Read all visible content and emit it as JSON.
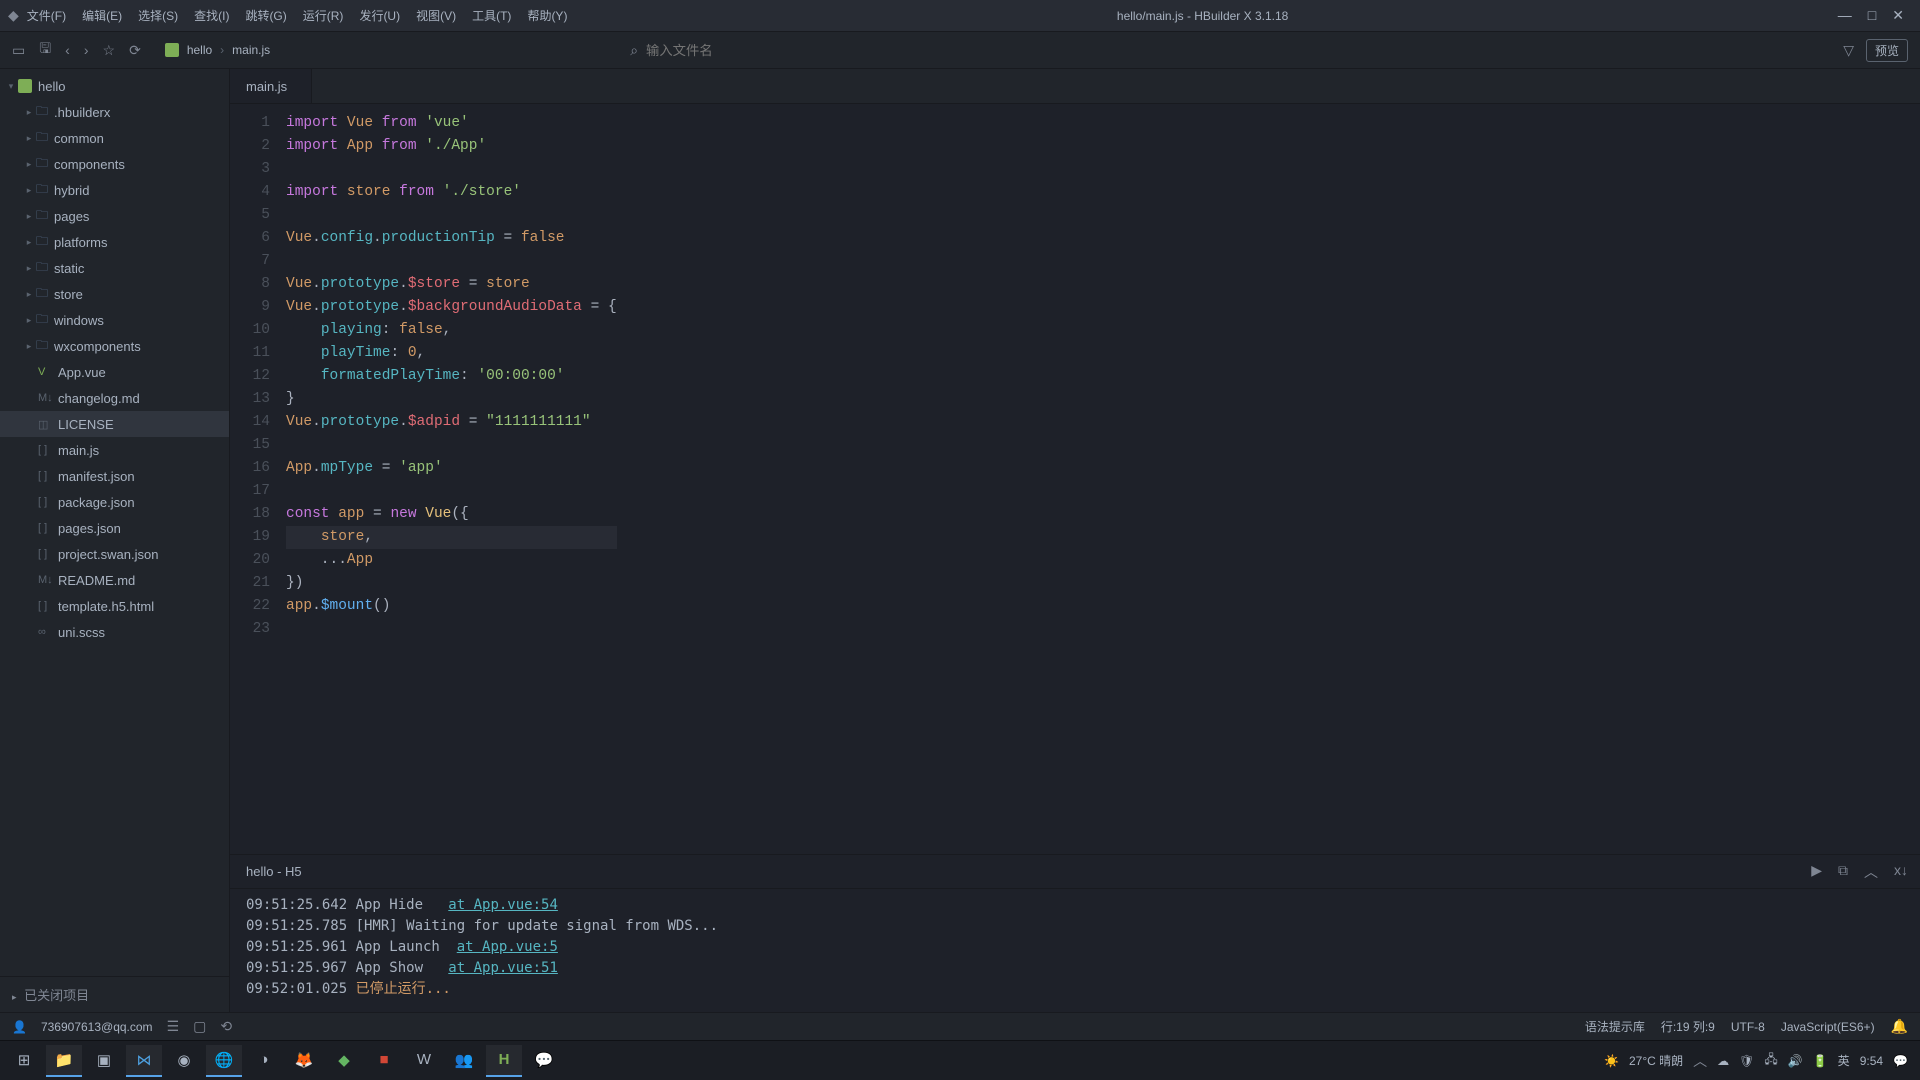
{
  "menubar": {
    "items": [
      "文件(F)",
      "编辑(E)",
      "选择(S)",
      "查找(I)",
      "跳转(G)",
      "运行(R)",
      "发行(U)",
      "视图(V)",
      "工具(T)",
      "帮助(Y)"
    ],
    "title": "hello/main.js - HBuilder X 3.1.18"
  },
  "toolbar": {
    "breadcrumb": {
      "root": "hello",
      "file": "main.js"
    },
    "search_placeholder": "输入文件名",
    "preview": "预览"
  },
  "sidebar": {
    "project": "hello",
    "folders": [
      ".hbuilderx",
      "common",
      "components",
      "hybrid",
      "pages",
      "platforms",
      "static",
      "store",
      "windows",
      "wxcomponents"
    ],
    "files": [
      {
        "icon": "V",
        "name": "App.vue",
        "color": "#7eae56"
      },
      {
        "icon": "M↓",
        "name": "changelog.md",
        "color": "#5a636f"
      },
      {
        "icon": "◫",
        "name": "LICENSE",
        "color": "#5a636f"
      },
      {
        "icon": "[ ]",
        "name": "main.js",
        "color": "#5a636f"
      },
      {
        "icon": "[ ]",
        "name": "manifest.json",
        "color": "#5a636f"
      },
      {
        "icon": "[ ]",
        "name": "package.json",
        "color": "#5a636f"
      },
      {
        "icon": "[ ]",
        "name": "pages.json",
        "color": "#5a636f"
      },
      {
        "icon": "[ ]",
        "name": "project.swan.json",
        "color": "#5a636f"
      },
      {
        "icon": "M↓",
        "name": "README.md",
        "color": "#5a636f"
      },
      {
        "icon": "[ ]",
        "name": "template.h5.html",
        "color": "#5a636f"
      },
      {
        "icon": "∞",
        "name": "uni.scss",
        "color": "#5a636f"
      }
    ],
    "closed_projects": "已关闭项目"
  },
  "tab": {
    "name": "main.js"
  },
  "code": {
    "lines": [
      {
        "n": 1,
        "t": [
          [
            "kw",
            "import"
          ],
          [
            "op",
            " "
          ],
          [
            "var",
            "Vue"
          ],
          [
            "op",
            " "
          ],
          [
            "kw",
            "from"
          ],
          [
            "op",
            " "
          ],
          [
            "str",
            "'vue'"
          ]
        ]
      },
      {
        "n": 2,
        "t": [
          [
            "kw",
            "import"
          ],
          [
            "op",
            " "
          ],
          [
            "var",
            "App"
          ],
          [
            "op",
            " "
          ],
          [
            "kw",
            "from"
          ],
          [
            "op",
            " "
          ],
          [
            "str",
            "'./App'"
          ]
        ]
      },
      {
        "n": 3,
        "t": [
          [
            "op",
            ""
          ]
        ]
      },
      {
        "n": 4,
        "t": [
          [
            "kw",
            "import"
          ],
          [
            "op",
            " "
          ],
          [
            "var",
            "store"
          ],
          [
            "op",
            " "
          ],
          [
            "kw",
            "from"
          ],
          [
            "op",
            " "
          ],
          [
            "str",
            "'./store'"
          ]
        ]
      },
      {
        "n": 5,
        "t": [
          [
            "op",
            ""
          ]
        ]
      },
      {
        "n": 6,
        "t": [
          [
            "var",
            "Vue"
          ],
          [
            "op",
            "."
          ],
          [
            "prop",
            "config"
          ],
          [
            "op",
            "."
          ],
          [
            "prop",
            "productionTip"
          ],
          [
            "op",
            " = "
          ],
          [
            "val",
            "false"
          ]
        ]
      },
      {
        "n": 7,
        "t": [
          [
            "op",
            ""
          ]
        ]
      },
      {
        "n": 8,
        "t": [
          [
            "var",
            "Vue"
          ],
          [
            "op",
            "."
          ],
          [
            "prop",
            "prototype"
          ],
          [
            "op",
            "."
          ],
          [
            "id",
            "$store"
          ],
          [
            "op",
            " = "
          ],
          [
            "var",
            "store"
          ]
        ]
      },
      {
        "n": 9,
        "t": [
          [
            "var",
            "Vue"
          ],
          [
            "op",
            "."
          ],
          [
            "prop",
            "prototype"
          ],
          [
            "op",
            "."
          ],
          [
            "id",
            "$backgroundAudioData"
          ],
          [
            "op",
            " = {"
          ]
        ]
      },
      {
        "n": 10,
        "t": [
          [
            "op",
            "    "
          ],
          [
            "prop",
            "playing"
          ],
          [
            "op",
            ": "
          ],
          [
            "val",
            "false"
          ],
          [
            "op",
            ","
          ]
        ]
      },
      {
        "n": 11,
        "t": [
          [
            "op",
            "    "
          ],
          [
            "prop",
            "playTime"
          ],
          [
            "op",
            ": "
          ],
          [
            "val",
            "0"
          ],
          [
            "op",
            ","
          ]
        ]
      },
      {
        "n": 12,
        "t": [
          [
            "op",
            "    "
          ],
          [
            "prop",
            "formatedPlayTime"
          ],
          [
            "op",
            ": "
          ],
          [
            "str",
            "'00:00:00'"
          ]
        ]
      },
      {
        "n": 13,
        "t": [
          [
            "op",
            "}"
          ]
        ]
      },
      {
        "n": 14,
        "t": [
          [
            "var",
            "Vue"
          ],
          [
            "op",
            "."
          ],
          [
            "prop",
            "prototype"
          ],
          [
            "op",
            "."
          ],
          [
            "id",
            "$adpid"
          ],
          [
            "op",
            " = "
          ],
          [
            "str",
            "\"1111111111\""
          ]
        ]
      },
      {
        "n": 15,
        "t": [
          [
            "op",
            ""
          ]
        ]
      },
      {
        "n": 16,
        "t": [
          [
            "var",
            "App"
          ],
          [
            "op",
            "."
          ],
          [
            "prop",
            "mpType"
          ],
          [
            "op",
            " = "
          ],
          [
            "str",
            "'app'"
          ]
        ]
      },
      {
        "n": 17,
        "t": [
          [
            "op",
            ""
          ]
        ]
      },
      {
        "n": 18,
        "t": [
          [
            "kw",
            "const"
          ],
          [
            "op",
            " "
          ],
          [
            "var",
            "app"
          ],
          [
            "op",
            " = "
          ],
          [
            "kw",
            "new"
          ],
          [
            "op",
            " "
          ],
          [
            "cls",
            "Vue"
          ],
          [
            "op",
            "({"
          ]
        ]
      },
      {
        "n": 19,
        "t": [
          [
            "op",
            "    "
          ],
          [
            "var",
            "store"
          ],
          [
            "op",
            ","
          ]
        ],
        "current": true
      },
      {
        "n": 20,
        "t": [
          [
            "op",
            "    ..."
          ],
          [
            "var",
            "App"
          ]
        ]
      },
      {
        "n": 21,
        "t": [
          [
            "op",
            "})"
          ]
        ]
      },
      {
        "n": 22,
        "t": [
          [
            "var",
            "app"
          ],
          [
            "op",
            "."
          ],
          [
            "fn",
            "$mount"
          ],
          [
            "op",
            "()"
          ]
        ]
      },
      {
        "n": 23,
        "t": [
          [
            "op",
            ""
          ]
        ]
      }
    ]
  },
  "console": {
    "tab": "hello - H5",
    "lines": [
      {
        "time": "09:51:25.642",
        "text": "App Hide   ",
        "link": "at App.vue:54"
      },
      {
        "time": "09:51:25.785",
        "text": "[HMR] Waiting for update signal from WDS..."
      },
      {
        "time": "09:51:25.961",
        "text": "App Launch  ",
        "link": "at App.vue:5"
      },
      {
        "time": "09:51:25.967",
        "text": "App Show   ",
        "link": "at App.vue:51"
      },
      {
        "time": "09:52:01.025",
        "stopped": "已停止运行..."
      }
    ]
  },
  "statusbar": {
    "user": "736907613@qq.com",
    "syntax": "语法提示库",
    "cursor": "行:19 列:9",
    "encoding": "UTF-8",
    "lang": "JavaScript(ES6+)"
  },
  "tray": {
    "weather": "27°C 晴朗",
    "ime": "英",
    "time": "9:54"
  }
}
